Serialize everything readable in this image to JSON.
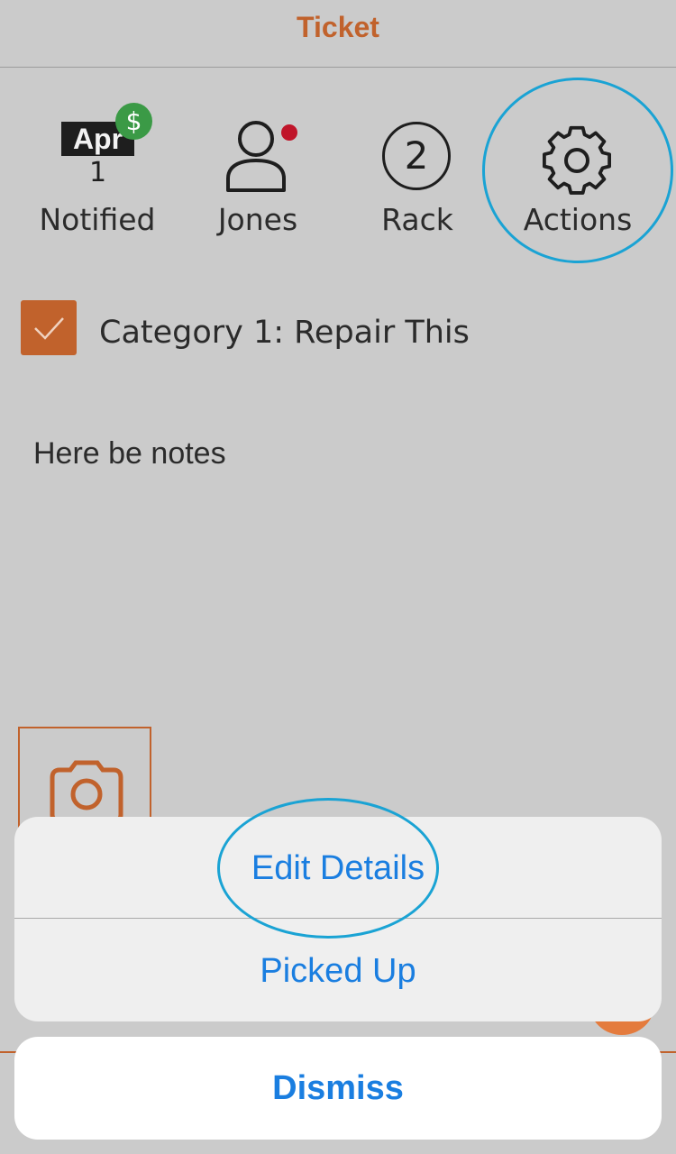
{
  "header": {
    "title": "Ticket"
  },
  "status": {
    "date": {
      "month": "Apr",
      "day": "1",
      "badge": "$"
    },
    "items": [
      {
        "label": "Notified"
      },
      {
        "label": "Jones"
      },
      {
        "label": "Rack",
        "value": "2"
      },
      {
        "label": "Actions"
      }
    ]
  },
  "category": {
    "label": "Category 1: Repair This",
    "checked": true
  },
  "notes": "Here be notes",
  "action_sheet": {
    "options": [
      {
        "label": "Edit Details"
      },
      {
        "label": "Picked Up"
      }
    ],
    "cancel": "Dismiss"
  },
  "colors": {
    "accent": "#c1622c",
    "ios_blue": "#1a7ee0",
    "paid_green": "#3b9a46",
    "unread_red": "#c0152a",
    "highlight": "#1aa3d4"
  }
}
